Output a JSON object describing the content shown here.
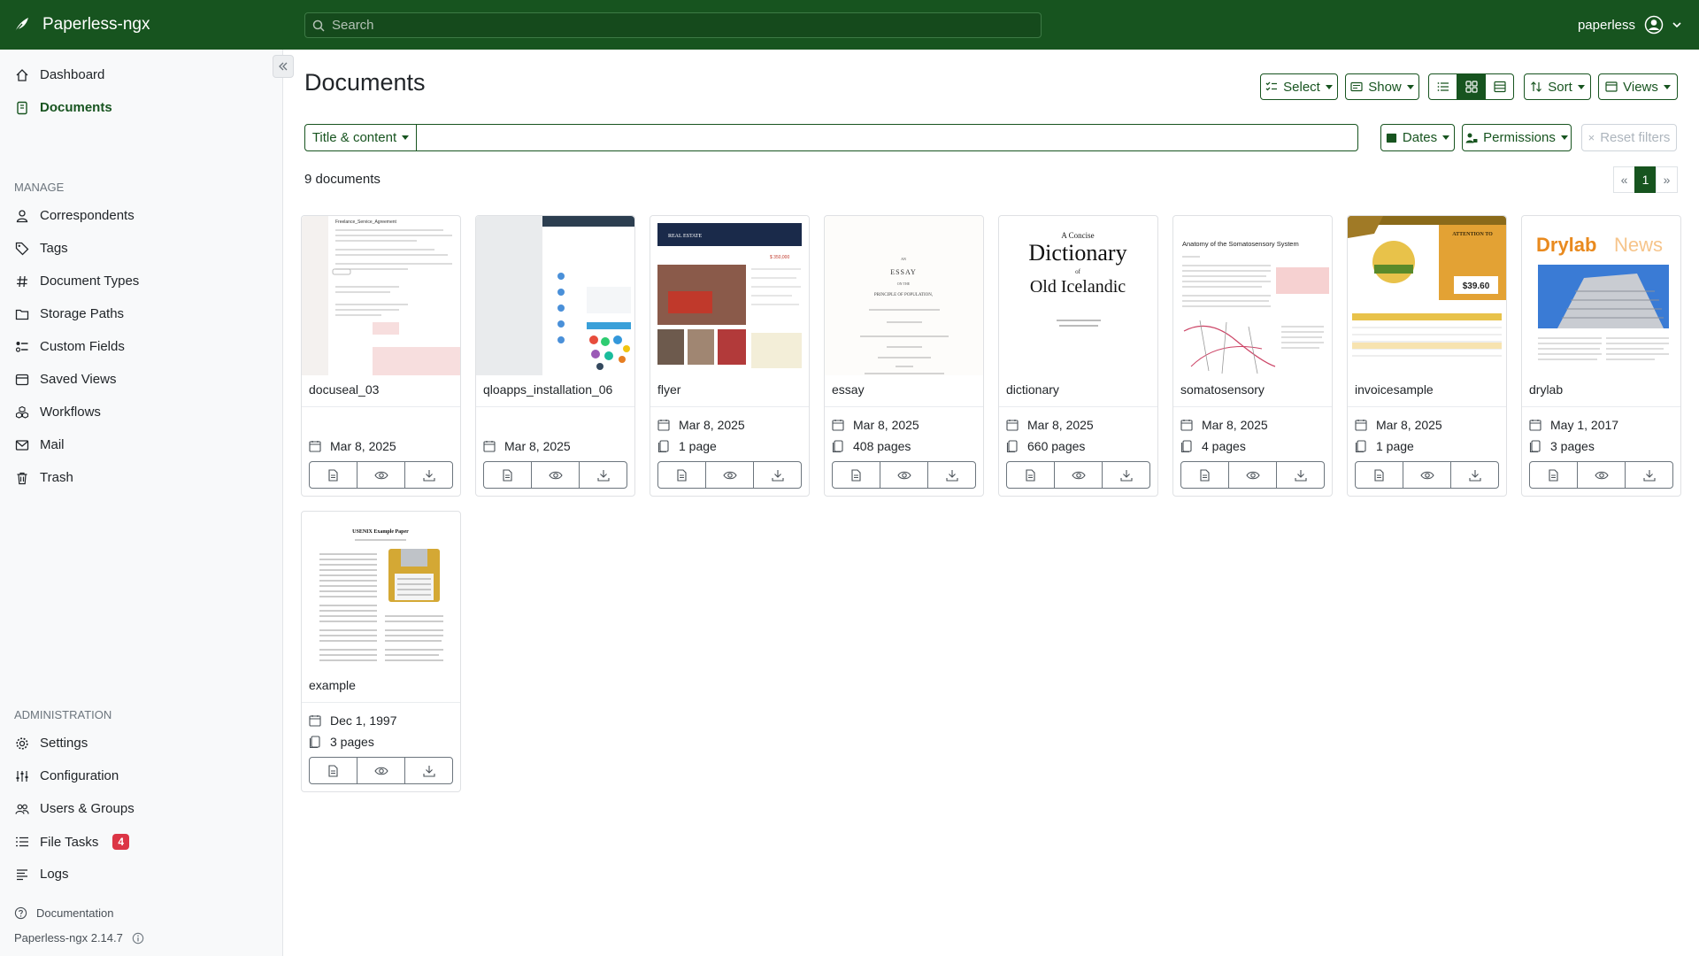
{
  "app": {
    "name": "Paperless-ngx",
    "user": "paperless"
  },
  "search": {
    "placeholder": "Search"
  },
  "sidebar": {
    "items": [
      {
        "label": "Dashboard",
        "icon": "house-icon"
      },
      {
        "label": "Documents",
        "icon": "file-icon"
      }
    ],
    "manage_label": "MANAGE",
    "manage": [
      {
        "label": "Correspondents",
        "icon": "person-icon"
      },
      {
        "label": "Tags",
        "icon": "tag-icon"
      },
      {
        "label": "Document Types",
        "icon": "hash-icon"
      },
      {
        "label": "Storage Paths",
        "icon": "folder-icon"
      },
      {
        "label": "Custom Fields",
        "icon": "ui-radios-icon"
      },
      {
        "label": "Saved Views",
        "icon": "window-stack-icon"
      },
      {
        "label": "Workflows",
        "icon": "boxes-icon"
      },
      {
        "label": "Mail",
        "icon": "envelope-icon"
      },
      {
        "label": "Trash",
        "icon": "trash-icon"
      }
    ],
    "admin_label": "ADMINISTRATION",
    "admin": [
      {
        "label": "Settings",
        "icon": "gear-icon"
      },
      {
        "label": "Configuration",
        "icon": "sliders-icon"
      },
      {
        "label": "Users & Groups",
        "icon": "people-icon"
      },
      {
        "label": "File Tasks",
        "icon": "list-task-icon",
        "badge": "4"
      },
      {
        "label": "Logs",
        "icon": "text-lines-icon"
      }
    ],
    "documentation": "Documentation",
    "version": "Paperless-ngx 2.14.7"
  },
  "main": {
    "title": "Documents",
    "toolbar": {
      "select": "Select",
      "show": "Show",
      "sort": "Sort",
      "views": "Views"
    },
    "filters": {
      "title_content": "Title & content",
      "dates": "Dates",
      "permissions": "Permissions",
      "reset": "Reset filters"
    },
    "count": "9 documents",
    "pagination": {
      "prev": "«",
      "current": "1",
      "next": "»"
    }
  },
  "documents": [
    {
      "title": "docuseal_03",
      "date": "Mar 8, 2025",
      "pages": ""
    },
    {
      "title": "qloapps_installation_06",
      "date": "Mar 8, 2025",
      "pages": ""
    },
    {
      "title": "flyer",
      "date": "Mar 8, 2025",
      "pages": "1 page"
    },
    {
      "title": "essay",
      "date": "Mar 8, 2025",
      "pages": "408 pages"
    },
    {
      "title": "dictionary",
      "date": "Mar 8, 2025",
      "pages": "660 pages"
    },
    {
      "title": "somatosensory",
      "date": "Mar 8, 2025",
      "pages": "4 pages"
    },
    {
      "title": "invoicesample",
      "date": "Mar 8, 2025",
      "pages": "1 page"
    },
    {
      "title": "drylab",
      "date": "May 1, 2017",
      "pages": "3 pages"
    },
    {
      "title": "example",
      "date": "Dec 1, 1997",
      "pages": "3 pages"
    }
  ],
  "thumbnail_text": {
    "docuseal": "Freelance_Service_Agreement",
    "flyer_brand": "REAL ESTATE",
    "flyer_price": "$ 350,000",
    "essay_1": "AN",
    "essay_2": "ESSAY",
    "essay_3": "ON THE",
    "essay_4": "PRINCIPLE OF POPULATION,",
    "dict_1": "A Concise",
    "dict_2": "Dictionary",
    "dict_3": "of",
    "dict_4": "Old Icelandic",
    "soma": "Anatomy of the Somatosensory System",
    "inv_attention": "ATTENTION TO",
    "inv_amount": "$39.60",
    "drylab_1": "Drylab",
    "drylab_2": "News",
    "example": "USENIX Example Paper"
  },
  "colors": {
    "brand": "#17541f",
    "badge": "#dc3545"
  }
}
